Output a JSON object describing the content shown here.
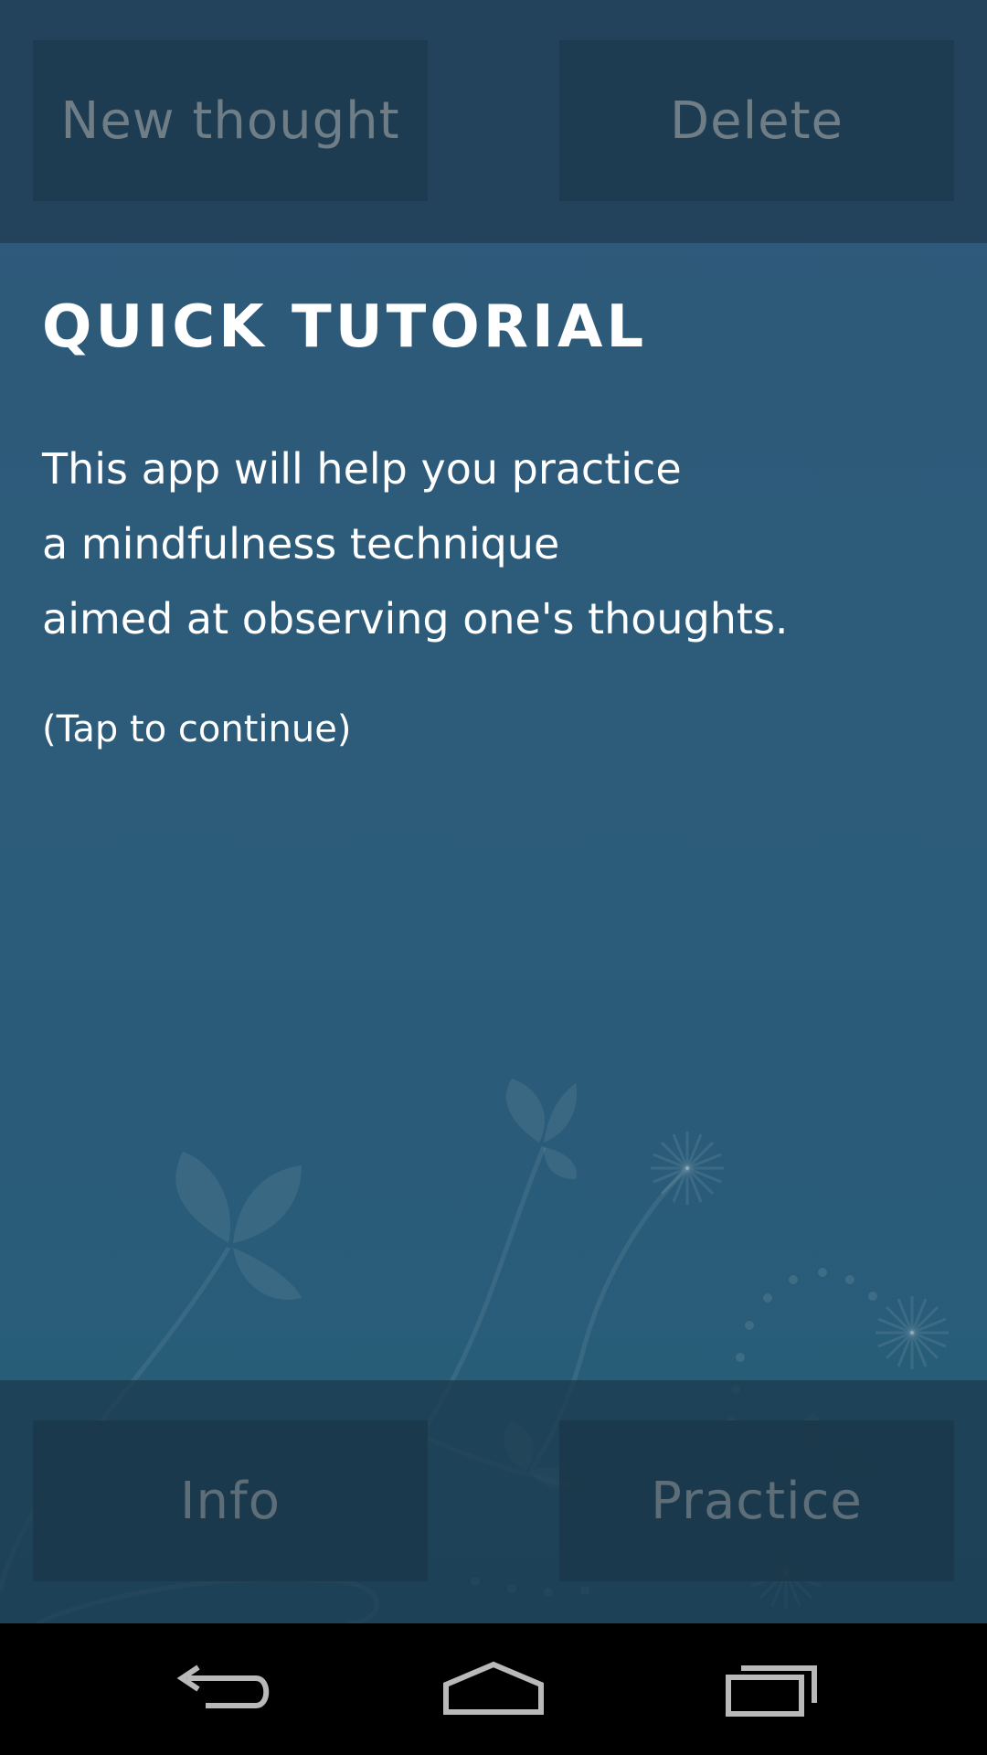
{
  "top_bar": {
    "new_thought_label": "New thought",
    "delete_label": "Delete"
  },
  "tutorial": {
    "title": "QUICK TUTORIAL",
    "lines": [
      "This app will help you practice",
      "a mindfulness technique",
      "aimed at observing one's thoughts."
    ],
    "hint": "(Tap to continue)"
  },
  "bottom_bar": {
    "info_label": "Info",
    "practice_label": "Practice"
  },
  "nav": {
    "back_icon": "back-arrow-icon",
    "home_icon": "home-icon",
    "recents_icon": "recent-apps-icon"
  },
  "colors": {
    "background": "#2c5c7a",
    "top_bar": "#23425b",
    "button": "#1e3c51",
    "button_text": "#6f7e86",
    "text": "#ffffff"
  }
}
